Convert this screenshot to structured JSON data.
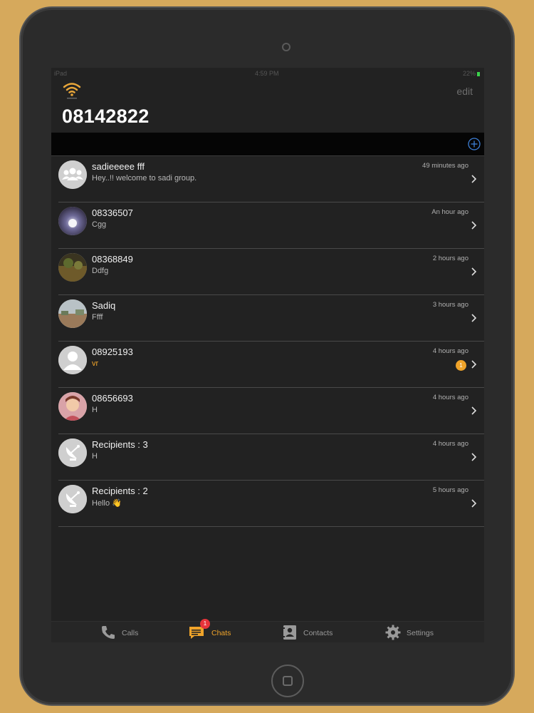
{
  "status_bar": {
    "carrier": "iPad",
    "time": "4:59 PM",
    "battery": "22%"
  },
  "header": {
    "edit_label": "edit",
    "title": "08142822"
  },
  "colors": {
    "accent": "#f0a42a",
    "background": "#222222",
    "badge": "#e8343a"
  },
  "chats": [
    {
      "name": "sadieeeee fff",
      "preview": "Hey..!! welcome to sadi group.",
      "time": "49 minutes ago",
      "avatar": "group-icon",
      "unread": false
    },
    {
      "name": "08336507",
      "preview": "Cgg",
      "time": "An hour ago",
      "avatar": "photo-apple",
      "unread": false
    },
    {
      "name": "08368849",
      "preview": "Ddfg",
      "time": "2 hours ago",
      "avatar": "photo-landscape",
      "unread": false
    },
    {
      "name": "Sadiq",
      "preview": "Ffff",
      "time": "3 hours ago",
      "avatar": "photo-field",
      "unread": false
    },
    {
      "name": "08925193",
      "preview": "vr",
      "time": "4 hours ago",
      "avatar": "person-icon",
      "unread": true,
      "unread_count": "1"
    },
    {
      "name": "08656693",
      "preview": "H",
      "time": "4 hours ago",
      "avatar": "photo-portrait",
      "unread": false
    },
    {
      "name": "Recipients : 3",
      "preview": "H",
      "time": "4 hours ago",
      "avatar": "broadcast-icon",
      "unread": false
    },
    {
      "name": "Recipients : 2",
      "preview": "Hello 👋",
      "time": "5 hours ago",
      "avatar": "broadcast-icon",
      "unread": false
    }
  ],
  "tabs": [
    {
      "label": "Calls",
      "icon": "phone-icon",
      "active": false
    },
    {
      "label": "Chats",
      "icon": "chat-icon",
      "active": true,
      "badge": "1"
    },
    {
      "label": "Contacts",
      "icon": "contacts-icon",
      "active": false
    },
    {
      "label": "Settings",
      "icon": "gear-icon",
      "active": false
    }
  ]
}
